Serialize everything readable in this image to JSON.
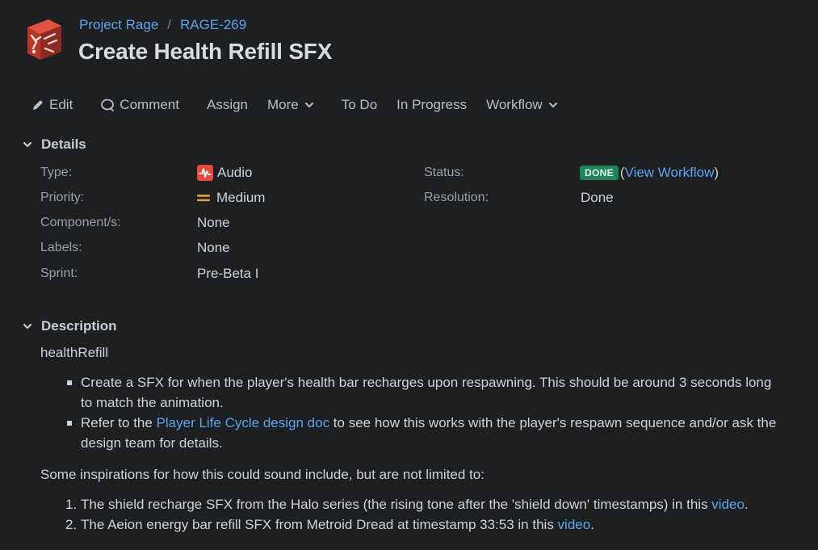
{
  "breadcrumb": {
    "project": "Project Rage",
    "separator": "/",
    "issue_key": "RAGE-269"
  },
  "issue": {
    "title": "Create Health Refill SFX"
  },
  "toolbar": {
    "edit": "Edit",
    "comment": "Comment",
    "assign": "Assign",
    "more": "More",
    "todo": "To Do",
    "in_progress": "In Progress",
    "workflow": "Workflow"
  },
  "details": {
    "heading": "Details",
    "type_label": "Type:",
    "type_value": "Audio",
    "priority_label": "Priority:",
    "priority_value": "Medium",
    "component_label": "Component/s:",
    "component_value": "None",
    "labels_label": "Labels:",
    "labels_value": "None",
    "sprint_label": "Sprint:",
    "sprint_value": "Pre-Beta I",
    "status_label": "Status:",
    "status_badge": "DONE",
    "status_paren_open": "(",
    "status_link": "View Workflow",
    "status_paren_close": ")",
    "resolution_label": "Resolution:",
    "resolution_value": "Done"
  },
  "description": {
    "heading": "Description",
    "intro": "healthRefill",
    "bullet1": "Create a SFX for when the player's health bar recharges upon respawning. This should be around 3 seconds long to match the animation.",
    "bullet2_pre": "Refer to the ",
    "bullet2_link": "Player Life Cycle design doc",
    "bullet2_post": " to see how this works with the player's respawn sequence and/or ask the design team for details.",
    "inspirations": "Some inspirations for how this could sound include, but are not limited to:",
    "item1_num": "1.",
    "item1_pre": "The shield recharge SFX from the Halo series (the rising tone after the 'shield down' timestamps) in this ",
    "item1_link": "video",
    "item1_post": ".",
    "item2_num": "2.",
    "item2_pre": "The Aeion energy bar refill SFX from Metroid Dread at timestamp 33:53 in this ",
    "item2_link": "video",
    "item2_post": "."
  },
  "icons": {
    "logo": "project-logo-icon",
    "edit": "pencil-icon",
    "comment": "speech-bubble-icon",
    "chevron": "chevron-down-icon",
    "audio": "audio-type-icon",
    "priority": "priority-medium-icon"
  },
  "colors": {
    "background": "#1d1f21",
    "link": "#5ba4f0",
    "done_badge": "#1f845a",
    "priority_medium": "#e9a23b",
    "audio_icon": "#e5493a"
  }
}
